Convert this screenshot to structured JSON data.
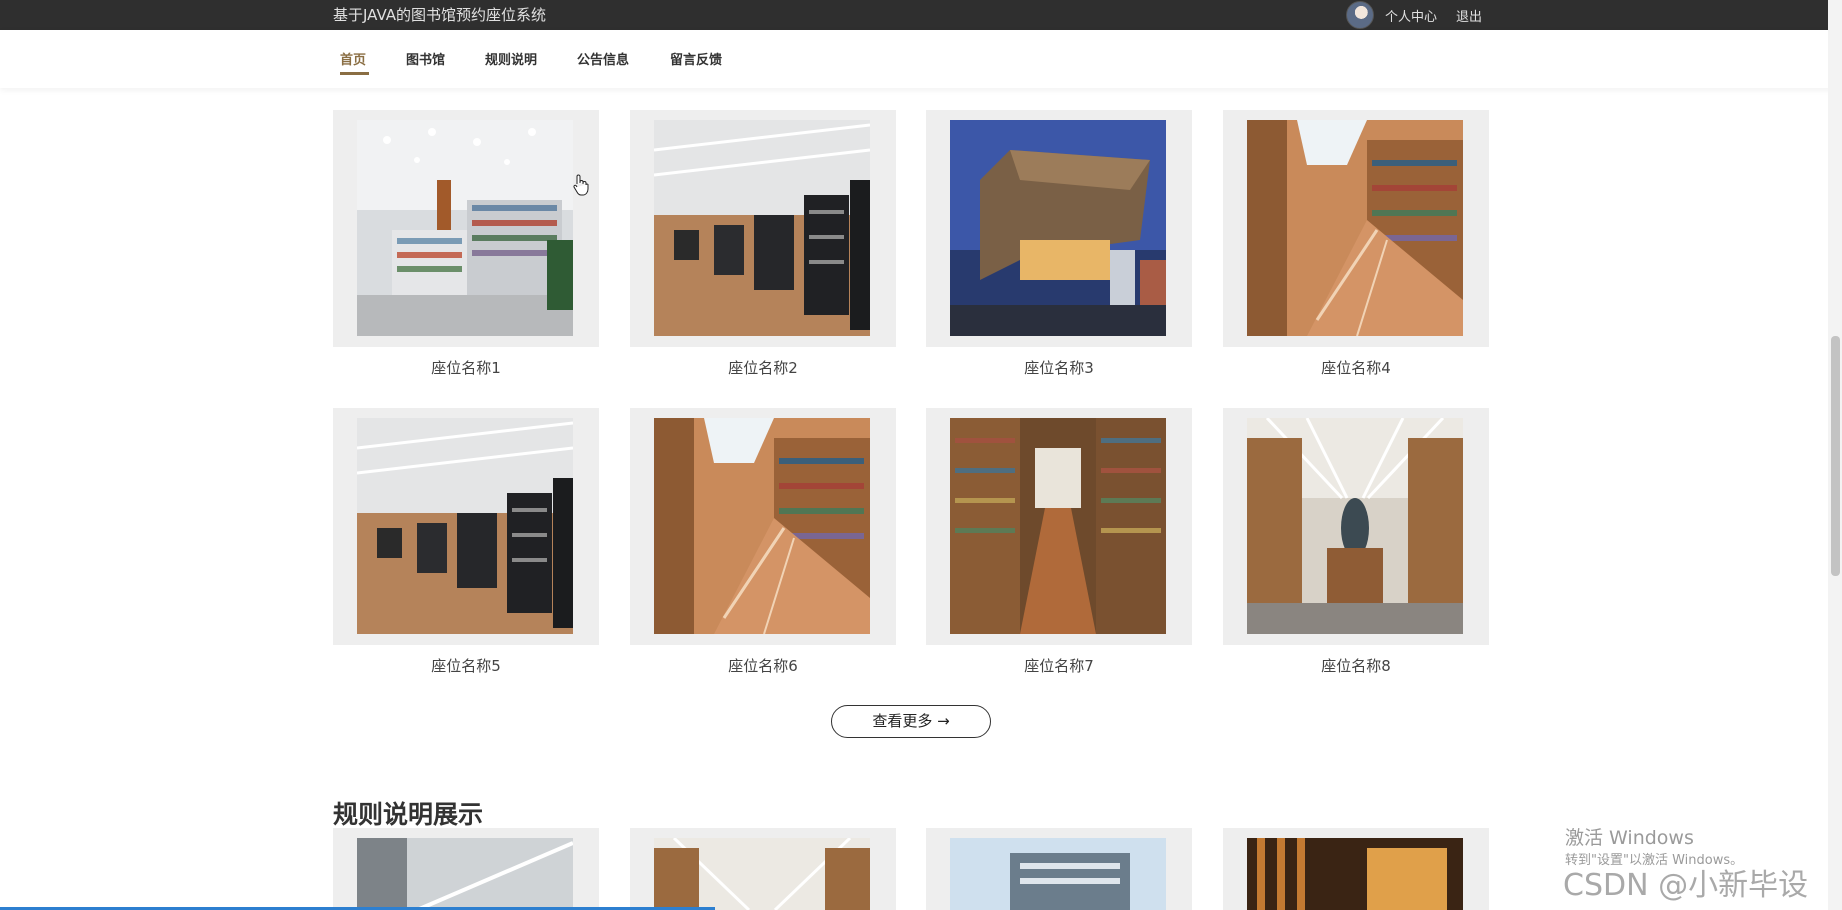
{
  "header": {
    "site_title": "基于JAVA的图书馆预约座位系统",
    "user_center": "个人中心",
    "logout": "退出"
  },
  "nav": {
    "items": [
      {
        "label": "首页",
        "active": true
      },
      {
        "label": "图书馆",
        "active": false
      },
      {
        "label": "规则说明",
        "active": false
      },
      {
        "label": "公告信息",
        "active": false
      },
      {
        "label": "留言反馈",
        "active": false
      }
    ]
  },
  "seats": [
    {
      "name": "座位名称1"
    },
    {
      "name": "座位名称2"
    },
    {
      "name": "座位名称3"
    },
    {
      "name": "座位名称4"
    },
    {
      "name": "座位名称5"
    },
    {
      "name": "座位名称6"
    },
    {
      "name": "座位名称7"
    },
    {
      "name": "座位名称8"
    }
  ],
  "more_button": "查看更多 →",
  "rules_section": {
    "title": "规则说明展示"
  },
  "watermark": {
    "activate": "激活 Windows",
    "hint": "转到\"设置\"以激活 Windows。",
    "csdn": "CSDN @小新毕设"
  },
  "colors": {
    "topbar": "#2f2f2f",
    "nav_active": "#8a6e43",
    "card_bg": "#eeeeee"
  }
}
